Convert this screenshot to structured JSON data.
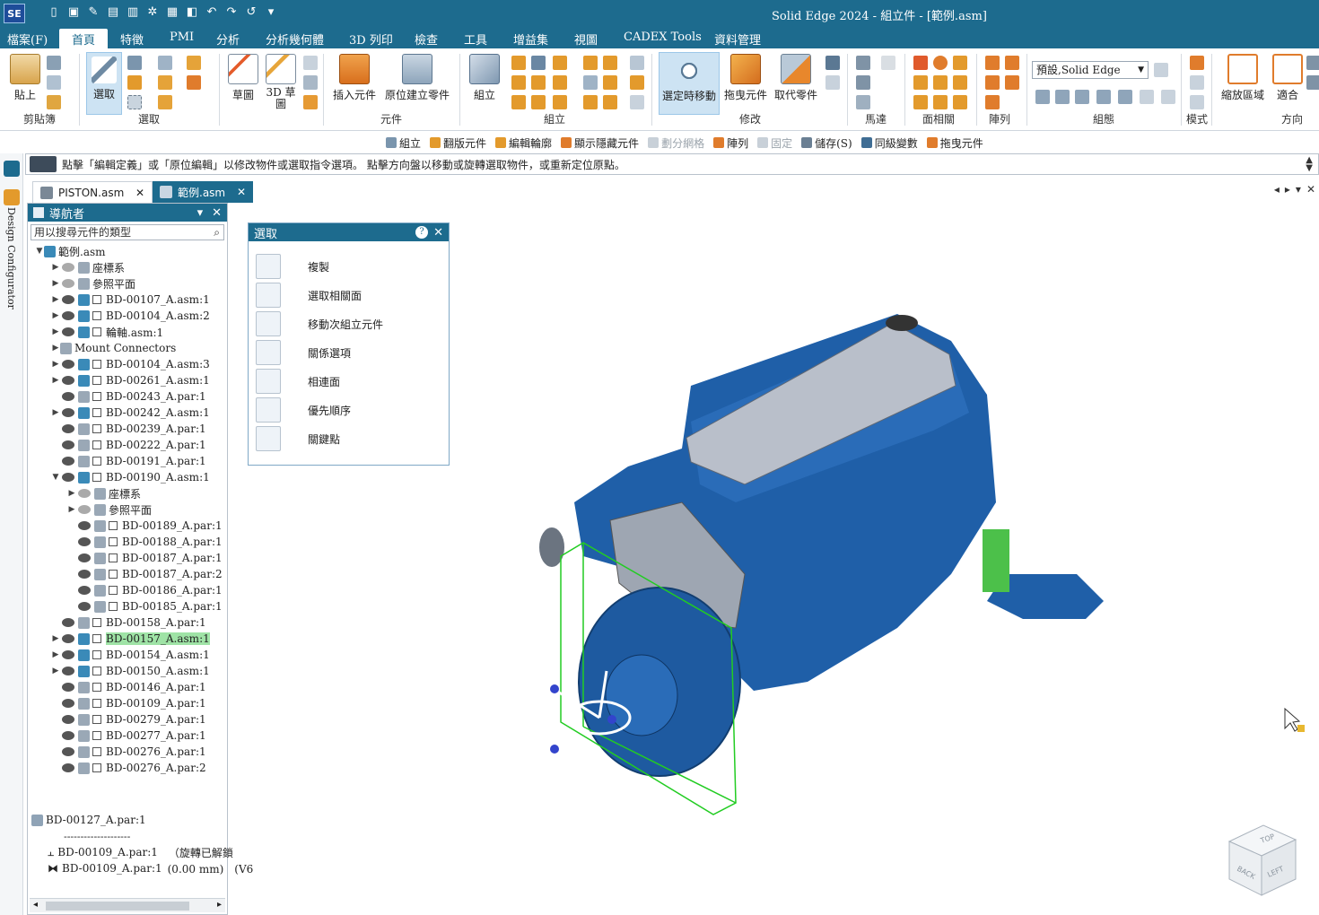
{
  "app": {
    "logo": "SE",
    "title": "Solid Edge 2024 - 組立件 - [範例.asm]",
    "accent": "#1d6b8e"
  },
  "menu": [
    "檔案(F)",
    "首頁",
    "特徵",
    "PMI",
    "分析",
    "分析幾何體",
    "3D 列印",
    "檢查",
    "工具",
    "增益集",
    "視圖",
    "CADEX Tools",
    "資料管理"
  ],
  "ribbon": {
    "paste": "貼上",
    "clipboard_group": "剪貼簿",
    "select": "選取",
    "select_group": "選取",
    "sketch": "草圖",
    "sketch3d": "3D 草圖",
    "insert_component": "插入元件",
    "create_in_place": "原位建立零件",
    "component_group": "元件",
    "assemble": "組立",
    "assemble_group": "組立",
    "move_on_select": "選定時移動",
    "drag_component": "拖曳元件",
    "replace_part": "取代零件",
    "modify_group": "修改",
    "motor_group": "馬達",
    "face_group": "面相關",
    "pattern_group": "陣列",
    "style_value": "預設,Solid Edge",
    "config_group": "組態",
    "mode_group": "模式",
    "zoom_area": "縮放區域",
    "fit": "適合",
    "orient_group": "方向"
  },
  "cmdbar": [
    {
      "label": "組立",
      "dim": false
    },
    {
      "label": "翻版元件",
      "dim": false
    },
    {
      "label": "編輯輪廓",
      "dim": false
    },
    {
      "label": "顯示隱藏元件",
      "dim": false
    },
    {
      "label": "劃分網格",
      "dim": true
    },
    {
      "label": "陣列",
      "dim": false
    },
    {
      "label": "固定",
      "dim": true
    },
    {
      "label": "儲存(S)",
      "dim": false
    },
    {
      "label": "同級變數",
      "dim": false
    },
    {
      "label": "拖曳元件",
      "dim": false
    }
  ],
  "prompt": "點擊「編輯定義」或「原位編輯」以修改物件或選取指令選項。 點擊方向盤以移動或旋轉選取物件，或重新定位原點。",
  "left_strip_label": "Design Configurator",
  "tabs": [
    {
      "label": "PISTON.asm",
      "close": "✕"
    },
    {
      "label": "範例.asm",
      "close": "✕"
    }
  ],
  "navigator": {
    "title": "導航者",
    "search_placeholder": "用以搜尋元件的類型",
    "rows": [
      {
        "label": "範例.asm",
        "indent": 0,
        "arrow": "▼",
        "eye": false
      },
      {
        "label": "座標系",
        "indent": 1,
        "arrow": "▶",
        "eye": true,
        "eyeoff": true
      },
      {
        "label": "參照平面",
        "indent": 1,
        "arrow": "▶",
        "eye": true,
        "eyeoff": true
      },
      {
        "label": "BD-00107_A.asm:1",
        "indent": 1,
        "arrow": "▶",
        "eye": true
      },
      {
        "label": "BD-00104_A.asm:2",
        "indent": 1,
        "arrow": "▶",
        "eye": true
      },
      {
        "label": "輪軸.asm:1",
        "indent": 1,
        "arrow": "▶",
        "eye": true
      },
      {
        "label": "Mount Connectors",
        "indent": 1,
        "arrow": "▶",
        "eye": false
      },
      {
        "label": "BD-00104_A.asm:3",
        "indent": 1,
        "arrow": "▶",
        "eye": true
      },
      {
        "label": "BD-00261_A.asm:1",
        "indent": 1,
        "arrow": "▶",
        "eye": true
      },
      {
        "label": "BD-00243_A.par:1",
        "indent": 1,
        "arrow": "",
        "eye": true
      },
      {
        "label": "BD-00242_A.asm:1",
        "indent": 1,
        "arrow": "▶",
        "eye": true
      },
      {
        "label": "BD-00239_A.par:1",
        "indent": 1,
        "arrow": "",
        "eye": true
      },
      {
        "label": "BD-00222_A.par:1",
        "indent": 1,
        "arrow": "",
        "eye": true
      },
      {
        "label": "BD-00191_A.par:1",
        "indent": 1,
        "arrow": "",
        "eye": true
      },
      {
        "label": "BD-00190_A.asm:1",
        "indent": 1,
        "arrow": "▼",
        "eye": true
      },
      {
        "label": "座標系",
        "indent": 2,
        "arrow": "▶",
        "eye": true,
        "eyeoff": true
      },
      {
        "label": "參照平面",
        "indent": 2,
        "arrow": "▶",
        "eye": true,
        "eyeoff": true
      },
      {
        "label": "BD-00189_A.par:1",
        "indent": 2,
        "arrow": "",
        "eye": true
      },
      {
        "label": "BD-00188_A.par:1",
        "indent": 2,
        "arrow": "",
        "eye": true
      },
      {
        "label": "BD-00187_A.par:1",
        "indent": 2,
        "arrow": "",
        "eye": true
      },
      {
        "label": "BD-00187_A.par:2",
        "indent": 2,
        "arrow": "",
        "eye": true
      },
      {
        "label": "BD-00186_A.par:1",
        "indent": 2,
        "arrow": "",
        "eye": true
      },
      {
        "label": "BD-00185_A.par:1",
        "indent": 2,
        "arrow": "",
        "eye": true
      },
      {
        "label": "BD-00158_A.par:1",
        "indent": 1,
        "arrow": "",
        "eye": true
      },
      {
        "label": "BD-00157_A.asm:1",
        "indent": 1,
        "arrow": "▶",
        "eye": true,
        "highlight": true
      },
      {
        "label": "BD-00154_A.asm:1",
        "indent": 1,
        "arrow": "▶",
        "eye": true
      },
      {
        "label": "BD-00150_A.asm:1",
        "indent": 1,
        "arrow": "▶",
        "eye": true
      },
      {
        "label": "BD-00146_A.par:1",
        "indent": 1,
        "arrow": "",
        "eye": true
      },
      {
        "label": "BD-00109_A.par:1",
        "indent": 1,
        "arrow": "",
        "eye": true
      },
      {
        "label": "BD-00279_A.par:1",
        "indent": 1,
        "arrow": "",
        "eye": true
      },
      {
        "label": "BD-00277_A.par:1",
        "indent": 1,
        "arrow": "",
        "eye": true
      },
      {
        "label": "BD-00276_A.par:1",
        "indent": 1,
        "arrow": "",
        "eye": true
      },
      {
        "label": "BD-00276_A.par:2",
        "indent": 1,
        "arrow": "",
        "eye": true
      }
    ],
    "detail_title": "BD-00127_A.par:1",
    "detail_sep": "--------------------",
    "detail_rows": [
      {
        "label": "BD-00109_A.par:1",
        "info": "（旋轉已解鎖"
      },
      {
        "label": "BD-00109_A.par:1",
        "info": "(0.00 mm)　(V6"
      }
    ]
  },
  "select_panel": {
    "title": "選取",
    "help": "?",
    "close": "✕",
    "items": [
      "複製",
      "選取相關面",
      "移動次組立元件",
      "關係選項",
      "相連面",
      "優先順序",
      "關鍵點"
    ]
  },
  "view_cube": {
    "top": "TOP",
    "back": "BACK",
    "left": "LEFT"
  }
}
